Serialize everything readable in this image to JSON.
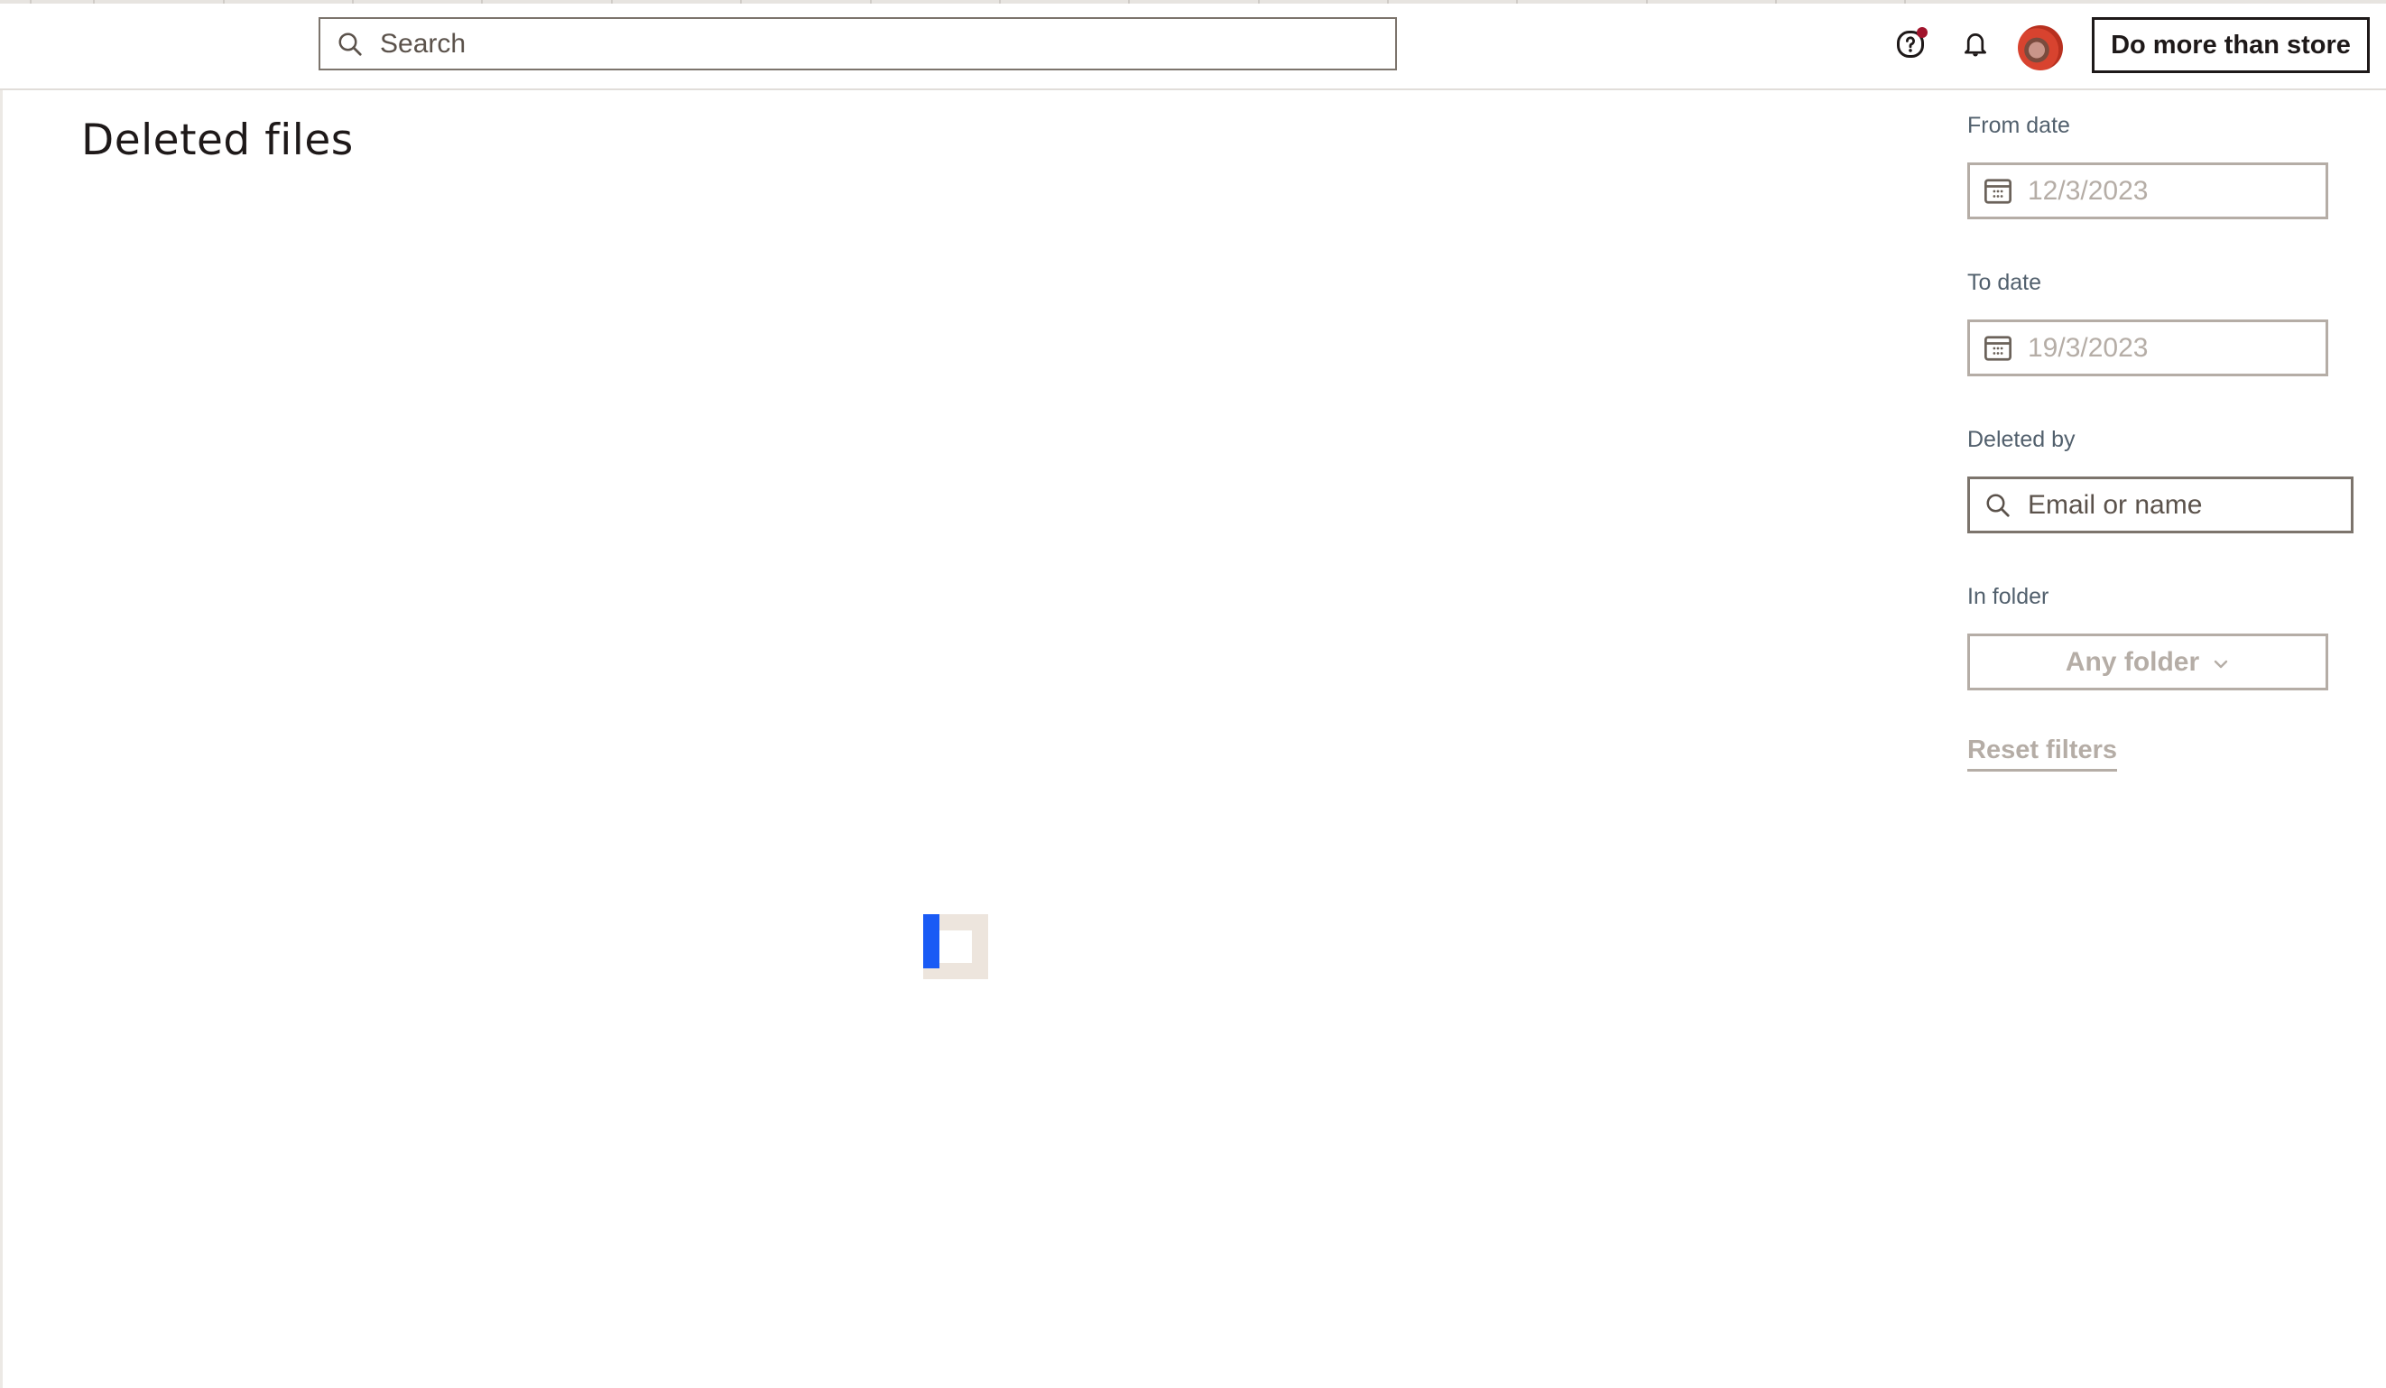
{
  "header": {
    "search": {
      "placeholder": "Search",
      "value": ""
    },
    "help_icon": "question-circle-icon",
    "help_has_notification": true,
    "notifications_icon": "bell-icon",
    "avatar": "user-avatar",
    "cta_label": "Do more than store"
  },
  "page": {
    "title": "Deleted files",
    "loading": true
  },
  "filters": {
    "from_date": {
      "label": "From date",
      "placeholder": "12/3/2023",
      "icon": "calendar-icon"
    },
    "to_date": {
      "label": "To date",
      "placeholder": "19/3/2023",
      "icon": "calendar-icon"
    },
    "deleted_by": {
      "label": "Deleted by",
      "placeholder": "Email or name",
      "icon": "search-icon"
    },
    "in_folder": {
      "label": "In folder",
      "selected": "Any folder",
      "icon": "chevron-down-icon"
    },
    "reset_label": "Reset filters"
  },
  "colors": {
    "accent": "#1a5bf5",
    "notification_dot": "#a1142c",
    "label": "#52606d",
    "disabled_text": "#b5ada6"
  }
}
